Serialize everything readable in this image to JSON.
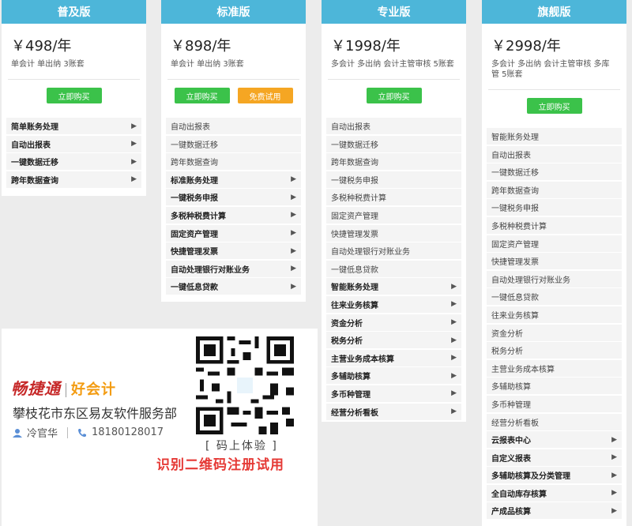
{
  "plans": [
    {
      "name": "普及版",
      "price": "￥498/年",
      "desc": "单会计 单出纳 3账套",
      "buttons": [
        {
          "label": "立即购买",
          "style": "green"
        }
      ],
      "features": [
        {
          "label": "简单账务处理",
          "bold": true,
          "arrow": true
        },
        {
          "label": "自动出报表",
          "bold": true,
          "arrow": true
        },
        {
          "label": "一键数据迁移",
          "bold": true,
          "arrow": true
        },
        {
          "label": "跨年数据查询",
          "bold": true,
          "arrow": true
        }
      ]
    },
    {
      "name": "标准版",
      "price": "￥898/年",
      "desc": "单会计 单出纳 3账套",
      "buttons": [
        {
          "label": "立即购买",
          "style": "green"
        },
        {
          "label": "免费试用",
          "style": "orange"
        }
      ],
      "features": [
        {
          "label": "自动出报表",
          "bold": false,
          "arrow": false
        },
        {
          "label": "一键数据迁移",
          "bold": false,
          "arrow": false
        },
        {
          "label": "跨年数据查询",
          "bold": false,
          "arrow": false
        },
        {
          "label": "标准账务处理",
          "bold": true,
          "arrow": true
        },
        {
          "label": "一键税务申报",
          "bold": true,
          "arrow": true
        },
        {
          "label": "多税种税费计算",
          "bold": true,
          "arrow": true
        },
        {
          "label": "固定资产管理",
          "bold": true,
          "arrow": true
        },
        {
          "label": "快捷管理发票",
          "bold": true,
          "arrow": true
        },
        {
          "label": "自动处理银行对账业务",
          "bold": true,
          "arrow": true
        },
        {
          "label": "一键低息贷款",
          "bold": true,
          "arrow": true
        }
      ]
    },
    {
      "name": "专业版",
      "price": "￥1998/年",
      "desc": "多会计 多出纳 会计主管审核 5账套",
      "buttons": [
        {
          "label": "立即购买",
          "style": "green"
        }
      ],
      "features": [
        {
          "label": "自动出报表",
          "bold": false,
          "arrow": false
        },
        {
          "label": "一键数据迁移",
          "bold": false,
          "arrow": false
        },
        {
          "label": "跨年数据查询",
          "bold": false,
          "arrow": false
        },
        {
          "label": "一键税务申报",
          "bold": false,
          "arrow": false
        },
        {
          "label": "多税种税费计算",
          "bold": false,
          "arrow": false
        },
        {
          "label": "固定资产管理",
          "bold": false,
          "arrow": false
        },
        {
          "label": "快捷管理发票",
          "bold": false,
          "arrow": false
        },
        {
          "label": "自动处理银行对账业务",
          "bold": false,
          "arrow": false
        },
        {
          "label": "一键低息贷款",
          "bold": false,
          "arrow": false
        },
        {
          "label": "智能账务处理",
          "bold": true,
          "arrow": true
        },
        {
          "label": "往来业务核算",
          "bold": true,
          "arrow": true
        },
        {
          "label": "资金分析",
          "bold": true,
          "arrow": true
        },
        {
          "label": "税务分析",
          "bold": true,
          "arrow": true
        },
        {
          "label": "主营业务成本核算",
          "bold": true,
          "arrow": true
        },
        {
          "label": "多辅助核算",
          "bold": true,
          "arrow": true
        },
        {
          "label": "多币种管理",
          "bold": true,
          "arrow": true
        },
        {
          "label": "经营分析看板",
          "bold": true,
          "arrow": true
        }
      ]
    },
    {
      "name": "旗舰版",
      "price": "￥2998/年",
      "desc": "多会计 多出纳 会计主管审核 多库管 5账套",
      "buttons": [
        {
          "label": "立即购买",
          "style": "green"
        }
      ],
      "features": [
        {
          "label": "智能账务处理",
          "bold": false,
          "arrow": false
        },
        {
          "label": "自动出报表",
          "bold": false,
          "arrow": false
        },
        {
          "label": "一键数据迁移",
          "bold": false,
          "arrow": false
        },
        {
          "label": "跨年数据查询",
          "bold": false,
          "arrow": false
        },
        {
          "label": "一键税务申报",
          "bold": false,
          "arrow": false
        },
        {
          "label": "多税种税费计算",
          "bold": false,
          "arrow": false
        },
        {
          "label": "固定资产管理",
          "bold": false,
          "arrow": false
        },
        {
          "label": "快捷管理发票",
          "bold": false,
          "arrow": false
        },
        {
          "label": "自动处理银行对账业务",
          "bold": false,
          "arrow": false
        },
        {
          "label": "一键低息贷款",
          "bold": false,
          "arrow": false
        },
        {
          "label": "往来业务核算",
          "bold": false,
          "arrow": false
        },
        {
          "label": "资金分析",
          "bold": false,
          "arrow": false
        },
        {
          "label": "税务分析",
          "bold": false,
          "arrow": false
        },
        {
          "label": "主营业务成本核算",
          "bold": false,
          "arrow": false
        },
        {
          "label": "多辅助核算",
          "bold": false,
          "arrow": false
        },
        {
          "label": "多币种管理",
          "bold": false,
          "arrow": false
        },
        {
          "label": "经营分析看板",
          "bold": false,
          "arrow": false
        },
        {
          "label": "云报表中心",
          "bold": true,
          "arrow": true
        },
        {
          "label": "自定义报表",
          "bold": true,
          "arrow": true
        },
        {
          "label": "多辅助核算及分类管理",
          "bold": true,
          "arrow": true
        },
        {
          "label": "全自动库存核算",
          "bold": true,
          "arrow": true
        },
        {
          "label": "产成品核算",
          "bold": true,
          "arrow": true
        }
      ]
    }
  ],
  "promo": {
    "logo_left": "畅捷通",
    "logo_right": "好会计",
    "company": "攀枝花市东区易友软件服务部",
    "person": "冷官华",
    "phone": "18180128017",
    "code_line": "[ 码上体验 ]",
    "scan_text": "识别二维码注册试用"
  },
  "colors": {
    "header": "#4db6d9",
    "buy": "#3bc24a",
    "trial": "#f5a623",
    "promo_red": "#e53935"
  }
}
